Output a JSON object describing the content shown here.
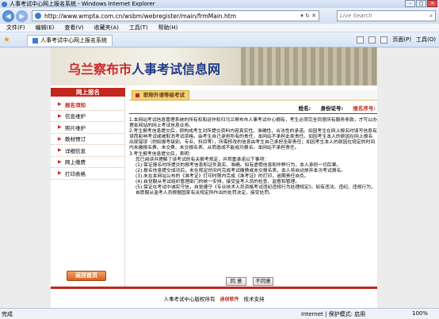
{
  "window": {
    "title": "人事考试中心网上报名系统 - Windows Internet Explorer"
  },
  "address": {
    "url": "http://www.wmpta.com.cn/wsbm/webregister/main/frmMain.htm",
    "search_placeholder": "Live Search"
  },
  "menu": [
    "文件(F)",
    "编辑(E)",
    "查看(V)",
    "收藏夹(A)",
    "工具(T)",
    "帮助(H)"
  ],
  "tab": {
    "label": "人事考试中心网上报名系统"
  },
  "toolbar": {
    "page_label": "页面(P)",
    "tools_label": "工具(O)"
  },
  "banner": {
    "title_red": "乌兰察布市",
    "title_blue": "人事考试信息网"
  },
  "sidebar": {
    "header": "网上报名",
    "items": [
      {
        "label": "报名须知"
      },
      {
        "label": "信息维护"
      },
      {
        "label": "照片维护"
      },
      {
        "label": "教材预订"
      },
      {
        "label": "详细信息"
      },
      {
        "label": "网上缴费"
      },
      {
        "label": "打印表格"
      }
    ],
    "return_label": "返回首页"
  },
  "main": {
    "tab_label": "职称外语等级考试",
    "info": {
      "name_label": "姓名:",
      "id_label": "身份证号:",
      "reg_label": "报名序号:"
    },
    "notice": [
      "1.本网站考试信息管理系统的所有权和运作权归乌兰察布市人事考试中心拥有，考生必须完全同意所有服务条款，才可以办理本网站的网上考试信息业务。",
      "2.考生报考信息提交后，即构成考生对所提交资料内容真实性、准确性、合法性的承诺。如因考生在网上报名时填写信息有误而影响考试或被取消考试资格，由考生自己承担所有的责任，本网站不承担此类责任。如因考生本人的原因在网上报名出现错误（例如报考级别、专业、科目等），所需修改的信息由考生自己承担全部责任；如因考生本人的原因在规定的时间内未缴报名费、未交费、未交报名表、从而造成不能成功报名，本网站不承担责任。",
      "3.考生报考信息提交后，表明：",
      "您已阅读并理解了该考试的有关报考规定，并郑重承诺以下事项：",
      "(1).保证报名时所提交的报考信息和证件真实、准确。如有虚假信息和作弊行为，本人承担一切后果。",
      "(2).报名信息提交成功后，未在规定时间内完成考试缴费或未交报名表，本人将自动放弃本次考试报名。",
      "(3).未在本网站公布的《准考证》打印时限内完成《准考证》的打印，逾期责任自负。",
      "(4).自觉服从考试组织管理部门的统一安排，接受监考人员的检查、监督和管理。",
      "(5).保证在考试中诚实守信，自觉遵守《专业技术人员资格考试违纪违规行为处理规定》。如有违法、违纪、违规行为，自愿服从监考人员根据国家有关规定所作出的处罚决定，接受处罚。"
    ],
    "agree_label": "同 意",
    "disagree_label": "不同意"
  },
  "footer": {
    "text1": "人事考试中心版权所有",
    "logo": "迪创软件",
    "text2": "技术支持"
  },
  "status": {
    "left": "完成",
    "zone": "Internet | 保护模式: 启用",
    "zoom": "100%"
  }
}
